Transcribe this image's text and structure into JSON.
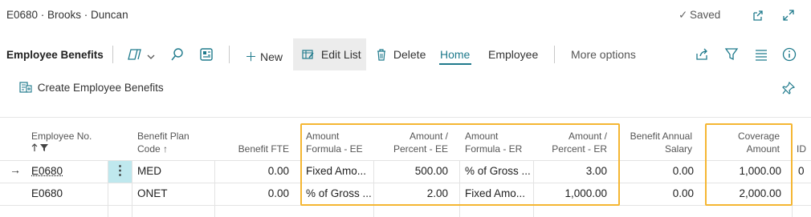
{
  "header": {
    "record_title": "E0680 · Brooks · Duncan",
    "saved_label": "Saved"
  },
  "actions": {
    "page_name": "Employee Benefits",
    "new_label": "New",
    "edit_list_label": "Edit List",
    "delete_label": "Delete",
    "home_tab": "Home",
    "employee_tab": "Employee",
    "more_options": "More options"
  },
  "subactions": {
    "create_label": "Create Employee Benefits"
  },
  "table": {
    "columns": {
      "employee_no": "Employee No.",
      "benefit_plan_code_1": "Benefit Plan",
      "benefit_plan_code_2": "Code",
      "benefit_fte": "Benefit FTE",
      "amount_formula_ee_1": "Amount",
      "amount_formula_ee_2": "Formula - EE",
      "amount_percent_ee_1": "Amount /",
      "amount_percent_ee_2": "Percent - EE",
      "amount_formula_er_1": "Amount",
      "amount_formula_er_2": "Formula - ER",
      "amount_percent_er_1": "Amount /",
      "amount_percent_er_2": "Percent - ER",
      "benefit_annual_salary_1": "Benefit Annual",
      "benefit_annual_salary_2": "Salary",
      "coverage_amount_1": "Coverage",
      "coverage_amount_2": "Amount",
      "id_partial": "ID"
    },
    "rows": [
      {
        "employee_no": "E0680",
        "benefit_plan_code": "MED",
        "benefit_fte": "0.00",
        "amount_formula_ee": "Fixed Amo...",
        "amount_percent_ee": "500.00",
        "amount_formula_er": "% of Gross ...",
        "amount_percent_er": "3.00",
        "benefit_annual_salary": "0.00",
        "coverage_amount": "1,000.00",
        "id_partial": "0"
      },
      {
        "employee_no": "E0680",
        "benefit_plan_code": "ONET",
        "benefit_fte": "0.00",
        "amount_formula_ee": "% of Gross ...",
        "amount_percent_ee": "2.00",
        "amount_formula_er": "Fixed Amo...",
        "amount_percent_er": "1,000.00",
        "benefit_annual_salary": "0.00",
        "coverage_amount": "2,000.00",
        "id_partial": ""
      }
    ]
  },
  "colors": {
    "accent": "#1f7a8c",
    "highlight_border": "#f5b632",
    "row_action_bg": "#bfe8ee"
  }
}
